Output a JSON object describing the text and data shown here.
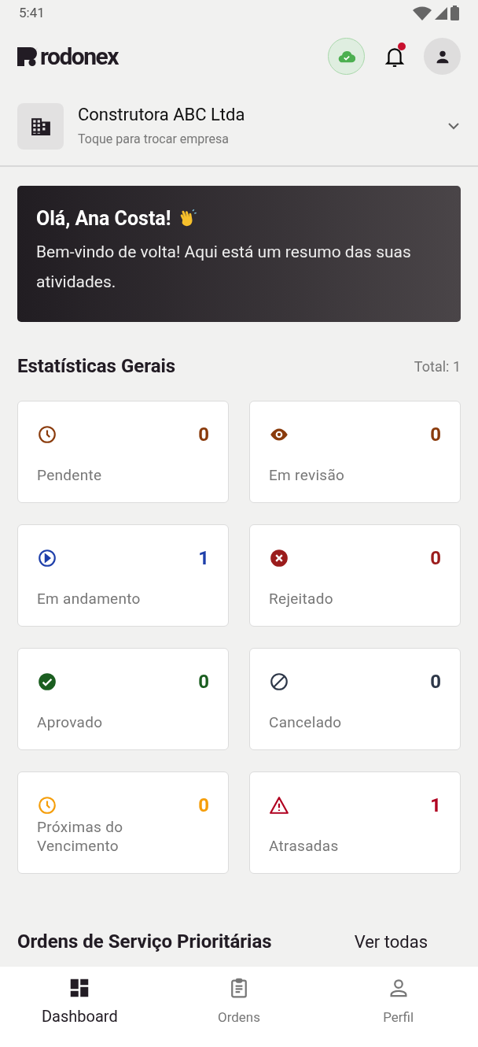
{
  "status_bar": {
    "time": "5:41"
  },
  "header": {
    "brand": "rodonex",
    "sync_ok": true,
    "has_notifications": true
  },
  "company": {
    "name": "Construtora ABC Ltda",
    "hint": "Toque para trocar empresa"
  },
  "welcome": {
    "title": "Olá, Ana Costa!",
    "message": "Bem-vindo de volta! Aqui está um resumo das suas atividades."
  },
  "stats": {
    "title": "Estatísticas Gerais",
    "total": "Total: 1",
    "items": [
      {
        "kind": "clock",
        "label": "Pendente",
        "count": "0",
        "color": "#8a3b0c"
      },
      {
        "kind": "eye",
        "label": "Em revisão",
        "count": "0",
        "color": "#8a3b0c"
      },
      {
        "kind": "play",
        "label": "Em andamento",
        "count": "1",
        "color": "#1e3faa"
      },
      {
        "kind": "rejected",
        "label": "Rejeitado",
        "count": "0",
        "color": "#9b1c1c"
      },
      {
        "kind": "approved",
        "label": "Aprovado",
        "count": "0",
        "color": "#1b5e20"
      },
      {
        "kind": "cancelled",
        "label": "Cancelado",
        "count": "0",
        "color": "#2d3748"
      },
      {
        "kind": "clock",
        "label": "Próximas do Vencimento",
        "count": "0",
        "color": "#f59e0b"
      },
      {
        "kind": "warning",
        "label": "Atrasadas",
        "count": "1",
        "color": "#b00020"
      }
    ]
  },
  "priority": {
    "title": "Ordens de Serviço Prioritárias",
    "link": "Ver todas"
  },
  "bottom_nav": [
    {
      "kind": "dashboard",
      "label": "Dashboard",
      "selected": true
    },
    {
      "kind": "orders",
      "label": "Ordens",
      "selected": false
    },
    {
      "kind": "profile",
      "label": "Perfil",
      "selected": false
    }
  ]
}
